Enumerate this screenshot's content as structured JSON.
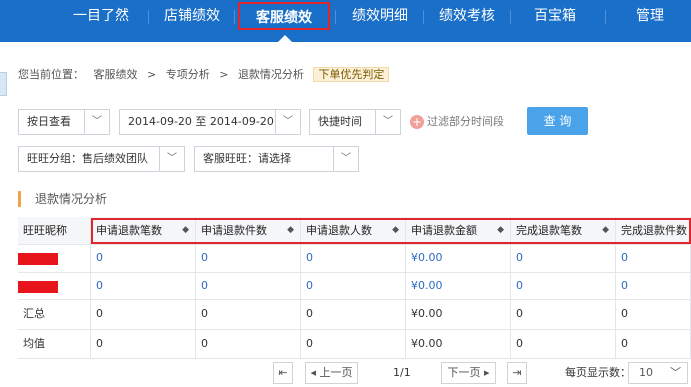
{
  "nav": {
    "items": [
      {
        "label": "一目了然"
      },
      {
        "label": "店铺绩效"
      },
      {
        "label": "客服绩效"
      },
      {
        "label": "绩效明细"
      },
      {
        "label": "绩效考核"
      },
      {
        "label": "百宝箱"
      },
      {
        "label": "管理"
      }
    ],
    "active_index": 2
  },
  "breadcrumb": {
    "prefix": "您当前位置：",
    "items": [
      "客服绩效",
      "专项分析",
      "退款情况分析"
    ],
    "separator": ">",
    "tag": "下单优先判定"
  },
  "filters": {
    "view_mode": "按日查看",
    "date_range": "2014-09-20 至 2014-09-20",
    "quick_time": "快捷时间",
    "filter_partial": "过滤部分时间段",
    "query_button": "查 询",
    "group": "旺旺分组：售后绩效团队",
    "service": "客服旺旺：请选择"
  },
  "section": {
    "title": "退款情况分析"
  },
  "table": {
    "headers": [
      "旺旺昵称",
      "申请退款笔数",
      "申请退款件数",
      "申请退款人数",
      "申请退款金额",
      "完成退款笔数",
      "完成退款件数"
    ],
    "rows": [
      {
        "name": "",
        "redacted": true,
        "values": [
          "0",
          "0",
          "0",
          "¥0.00",
          "0",
          "0"
        ],
        "linked": true
      },
      {
        "name": "",
        "redacted": true,
        "values": [
          "0",
          "0",
          "0",
          "¥0.00",
          "0",
          "0"
        ],
        "linked": true
      },
      {
        "name": "汇总",
        "redacted": false,
        "values": [
          "0",
          "0",
          "0",
          "¥0.00",
          "0",
          "0"
        ],
        "linked": false
      },
      {
        "name": "均值",
        "redacted": false,
        "values": [
          "0",
          "0",
          "0",
          "¥0.00",
          "0",
          "0"
        ],
        "linked": false
      }
    ]
  },
  "pagination": {
    "first": "⇤",
    "prev": "上一页",
    "page": "1/1",
    "next": "下一页",
    "last": "⇥",
    "per_page_label": "每页显示数：",
    "per_page": "10"
  },
  "colors": {
    "topbar": "#1a6fc8",
    "highlight": "#e0262b",
    "query_button": "#4aa3e8",
    "link": "#2d6bc1"
  }
}
